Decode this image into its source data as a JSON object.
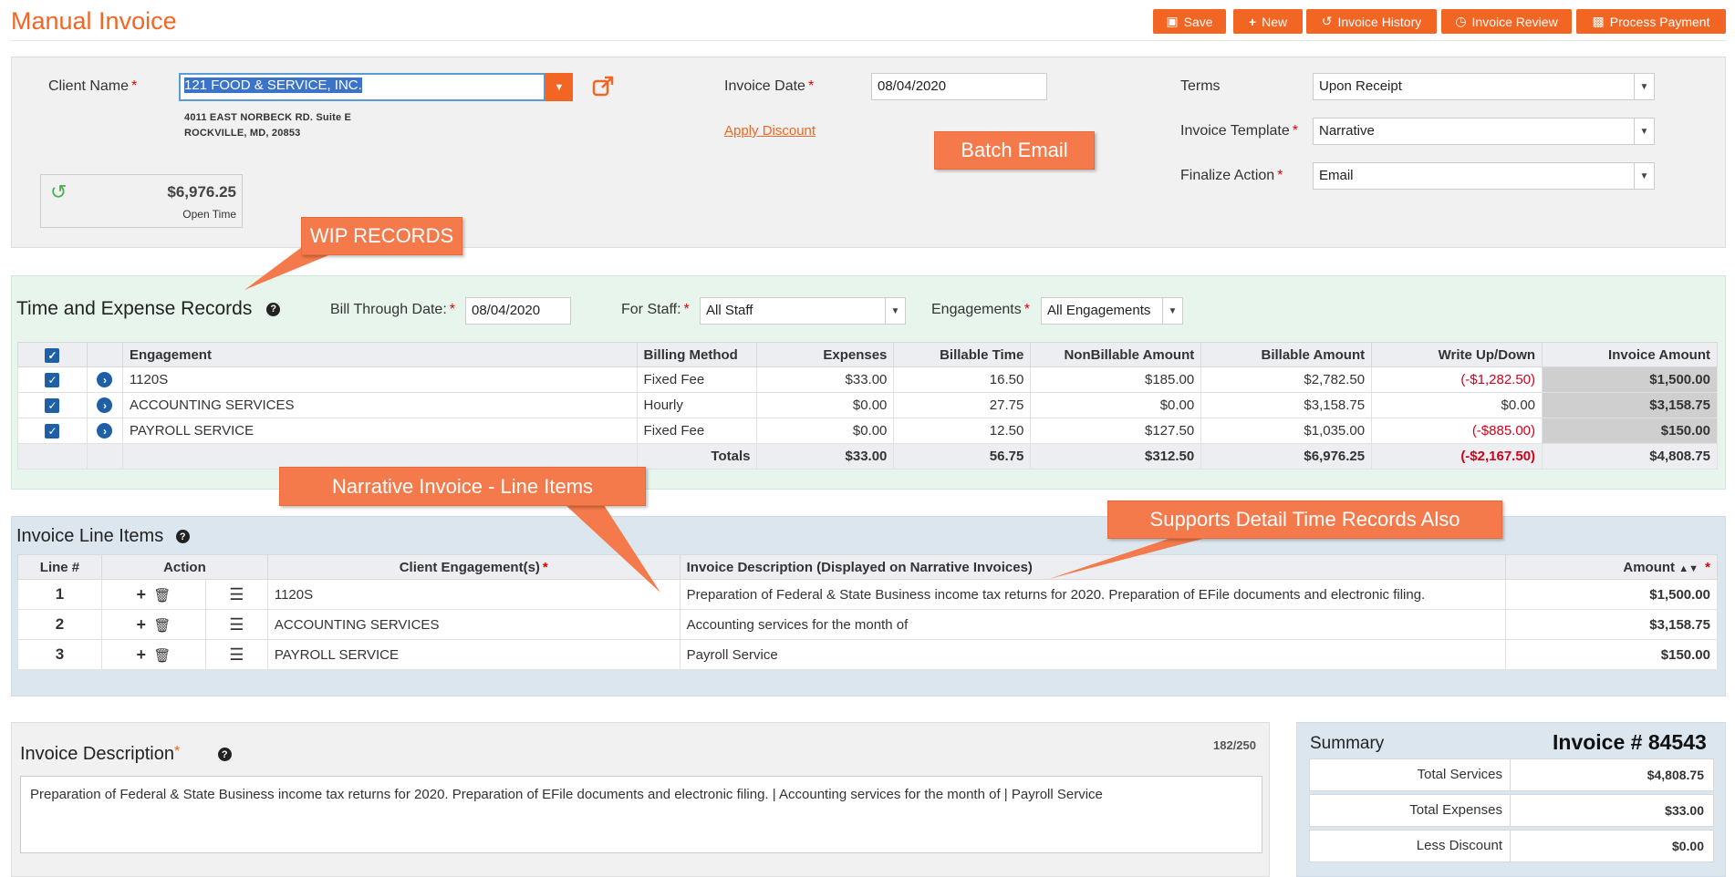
{
  "header": {
    "title": "Manual Invoice",
    "buttons": [
      {
        "label": "Save",
        "icon": "save-icon"
      },
      {
        "label": "New",
        "icon": "plus-icon"
      },
      {
        "label": "Invoice History",
        "icon": "history-icon"
      },
      {
        "label": "Invoice Review",
        "icon": "clock-icon"
      },
      {
        "label": "Process Payment",
        "icon": "money-icon"
      }
    ]
  },
  "client": {
    "name_label": "Client Name",
    "name_value": "121 FOOD & SERVICE, INC.",
    "address_line1": "4011 EAST NORBECK RD. Suite E",
    "address_line2": "ROCKVILLE, MD, 20853",
    "open_time_amount": "$6,976.25",
    "open_time_label": "Open Time",
    "invoice_date_label": "Invoice Date",
    "invoice_date_value": "08/04/2020",
    "apply_discount": "Apply Discount",
    "terms_label": "Terms",
    "terms_value": "Upon Receipt",
    "template_label": "Invoice Template",
    "template_value": "Narrative",
    "finalize_label": "Finalize Action",
    "finalize_value": "Email"
  },
  "wip": {
    "title": "Time and Expense Records",
    "bill_through_label": "Bill Through Date:",
    "bill_through_value": "08/04/2020",
    "staff_label": "For Staff:",
    "staff_value": "All Staff",
    "engagements_label": "Engagements",
    "engagements_value": "All Engagements",
    "columns": [
      "Engagement",
      "Billing Method",
      "Expenses",
      "Billable Time",
      "NonBillable Amount",
      "Billable Amount",
      "Write Up/Down",
      "Invoice Amount"
    ],
    "rows": [
      {
        "engagement": "1120S",
        "method": "Fixed Fee",
        "expenses": "$33.00",
        "time": "16.50",
        "nonbillable": "$185.00",
        "billable": "$2,782.50",
        "writeup": "(-$1,282.50)",
        "invoice": "$1,500.00"
      },
      {
        "engagement": "ACCOUNTING SERVICES",
        "method": "Hourly",
        "expenses": "$0.00",
        "time": "27.75",
        "nonbillable": "$0.00",
        "billable": "$3,158.75",
        "writeup": "$0.00",
        "invoice": "$3,158.75"
      },
      {
        "engagement": "PAYROLL SERVICE",
        "method": "Fixed Fee",
        "expenses": "$0.00",
        "time": "12.50",
        "nonbillable": "$127.50",
        "billable": "$1,035.00",
        "writeup": "(-$885.00)",
        "invoice": "$150.00"
      }
    ],
    "totals": {
      "label": "Totals",
      "expenses": "$33.00",
      "time": "56.75",
      "nonbillable": "$312.50",
      "billable": "$6,976.25",
      "writeup": "(-$2,167.50)",
      "invoice": "$4,808.75"
    }
  },
  "lines": {
    "title": "Invoice Line Items",
    "columns": [
      "Line #",
      "Action",
      "Client Engagement(s)",
      "Invoice Description (Displayed on Narrative Invoices)",
      "Amount"
    ],
    "rows": [
      {
        "num": "1",
        "engagement": "1120S",
        "description": "Preparation of Federal & State Business income tax returns for 2020. Preparation of EFile documents and electronic filing.",
        "amount": "$1,500.00"
      },
      {
        "num": "2",
        "engagement": "ACCOUNTING SERVICES",
        "description": "Accounting services for the month of",
        "amount": "$3,158.75"
      },
      {
        "num": "3",
        "engagement": "PAYROLL SERVICE",
        "description": "Payroll Service",
        "amount": "$150.00"
      }
    ]
  },
  "description": {
    "title": "Invoice Description",
    "counter": "182/250",
    "text": "Preparation of Federal & State Business income tax returns for 2020.   Preparation of EFile documents and electronic filing. | Accounting services for the month of  | Payroll Service"
  },
  "summary": {
    "title": "Summary",
    "invoice_number": "Invoice # 84543",
    "rows": [
      {
        "label": "Total Services",
        "value": "$4,808.75"
      },
      {
        "label": "Total Expenses",
        "value": "$33.00"
      },
      {
        "label": "Less Discount",
        "value": "$0.00"
      }
    ]
  },
  "callouts": {
    "batch_email": "Batch Email",
    "wip_records": "WIP RECORDS",
    "narrative": "Narrative Invoice - Line Items",
    "supports": "Supports Detail Time Records Also"
  },
  "colors": {
    "accent": "#f26522",
    "negative": "#d0021b",
    "checkbox": "#1f5fa6"
  }
}
